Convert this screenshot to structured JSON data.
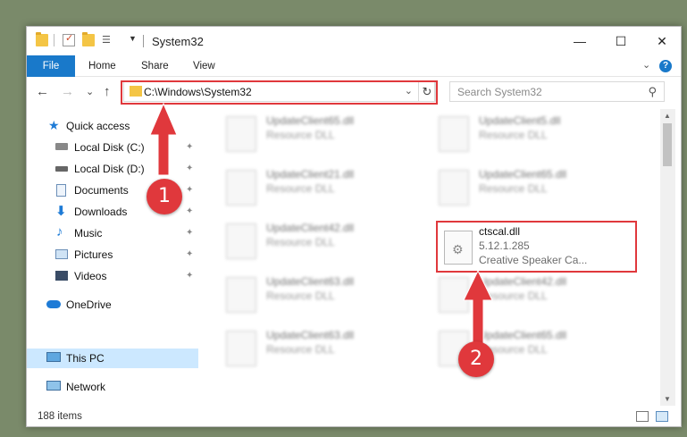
{
  "window": {
    "title": "System32"
  },
  "window_controls": {
    "minimize": "—",
    "maximize": "☐",
    "close": "✕"
  },
  "ribbon": {
    "tabs": [
      "File",
      "Home",
      "Share",
      "View"
    ],
    "expand": "⌄",
    "help": "?"
  },
  "nav": {
    "back": "←",
    "forward": "→",
    "recent": "⌄",
    "up": "↑",
    "address": "C:\\Windows\\System32",
    "address_drop": "⌄",
    "refresh": "↻",
    "search_placeholder": "Search System32",
    "search_icon": "⚲"
  },
  "sidebar": {
    "items": [
      {
        "label": "Quick access",
        "icon": "star-icon"
      },
      {
        "label": "Local Disk (C:)",
        "icon": "drive-icon",
        "pinned": true
      },
      {
        "label": "Local Disk (D:)",
        "icon": "drive-icon",
        "pinned": true
      },
      {
        "label": "Documents",
        "icon": "documents-icon",
        "pinned": true
      },
      {
        "label": "Downloads",
        "icon": "downloads-icon",
        "pinned": true
      },
      {
        "label": "Music",
        "icon": "music-icon",
        "pinned": true
      },
      {
        "label": "Pictures",
        "icon": "pictures-icon",
        "pinned": true
      },
      {
        "label": "Videos",
        "icon": "videos-icon",
        "pinned": true
      },
      {
        "label": "OneDrive",
        "icon": "onedrive-icon"
      },
      {
        "label": "This PC",
        "icon": "pc-icon",
        "selected": true
      },
      {
        "label": "Network",
        "icon": "network-icon"
      }
    ],
    "pin_glyph": "📌"
  },
  "files": {
    "left": [
      {
        "name": "UpdateClient65.dll",
        "type": "Resource DLL"
      },
      {
        "name": "UpdateClient21.dll",
        "type": "Resource DLL"
      },
      {
        "name": "UpdateClient42.dll",
        "type": "Resource DLL"
      },
      {
        "name": "UpdateClient63.dll",
        "type": "Resource DLL"
      },
      {
        "name": "UpdateClient63.dll",
        "type": "Resource DLL"
      }
    ],
    "right": [
      {
        "name": "UpdateClient5.dll",
        "type": "Resource DLL"
      },
      {
        "name": "UpdateClient65.dll",
        "type": "Resource DLL"
      },
      {
        "name": "ctscal.dll",
        "version": "5.12.1.285",
        "type": "Creative Speaker Ca..."
      },
      {
        "name": "UpdateClient42.dll",
        "type": "Resource DLL"
      },
      {
        "name": "UpdateClient65.dll",
        "type": "Resource DLL"
      }
    ]
  },
  "status": {
    "count": "188 items"
  },
  "annotations": {
    "step1": "1",
    "step2": "2",
    "color": "#e0383c"
  }
}
